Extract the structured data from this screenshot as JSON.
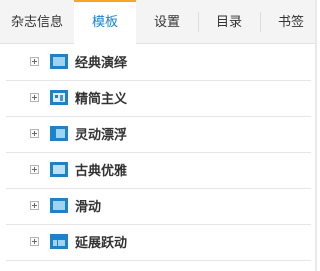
{
  "tabs": [
    {
      "label": "杂志信息",
      "active": false
    },
    {
      "label": "模板",
      "active": true
    },
    {
      "label": "设置",
      "active": false
    },
    {
      "label": "目录",
      "active": false
    },
    {
      "label": "书签",
      "active": false
    }
  ],
  "templates": [
    {
      "label": "经典演绎",
      "icon": "template-classic-icon"
    },
    {
      "label": "精简主义",
      "icon": "template-minimal-icon"
    },
    {
      "label": "灵动漂浮",
      "icon": "template-float-icon"
    },
    {
      "label": "古典优雅",
      "icon": "template-elegant-icon"
    },
    {
      "label": "滑动",
      "icon": "template-slide-icon"
    },
    {
      "label": "延展跃动",
      "icon": "template-extend-icon"
    }
  ],
  "colors": {
    "accent": "#1a7fd6",
    "active_tab_top": "#f5a623",
    "icon_blue": "#1e82c8"
  }
}
